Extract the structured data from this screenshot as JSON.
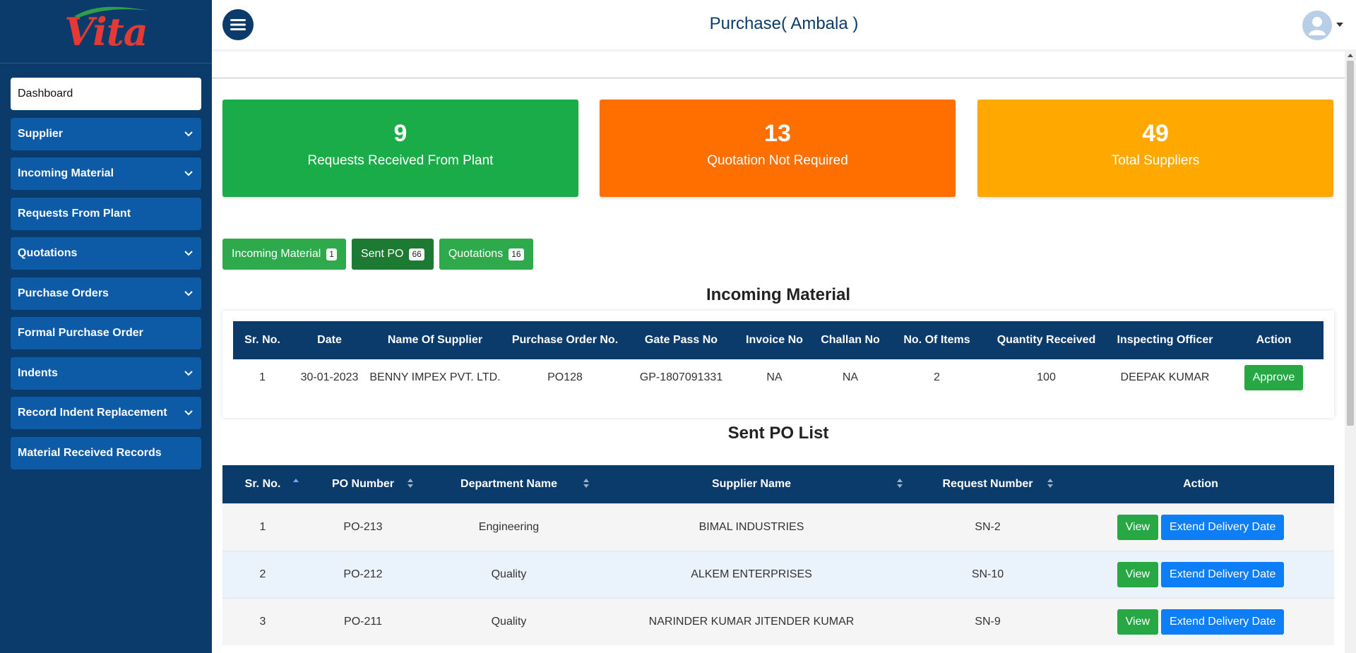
{
  "brand": {
    "logo_text": "Vita"
  },
  "header": {
    "title": "Purchase( Ambala )"
  },
  "sidebar": {
    "items": [
      {
        "label": "Dashboard",
        "has_submenu": false,
        "active": true
      },
      {
        "label": "Supplier",
        "has_submenu": true
      },
      {
        "label": "Incoming Material",
        "has_submenu": true
      },
      {
        "label": "Requests From Plant",
        "has_submenu": false
      },
      {
        "label": "Quotations",
        "has_submenu": true
      },
      {
        "label": "Purchase Orders",
        "has_submenu": true
      },
      {
        "label": "Formal Purchase Order",
        "has_submenu": false
      },
      {
        "label": "Indents",
        "has_submenu": true
      },
      {
        "label": "Record Indent Replacement",
        "has_submenu": true
      },
      {
        "label": "Material Received Records",
        "has_submenu": false
      }
    ]
  },
  "cards": [
    {
      "value": "9",
      "label": "Requests Received From Plant",
      "color": "#1aac48"
    },
    {
      "value": "13",
      "label": "Quotation Not Required",
      "color": "#ff6f00"
    },
    {
      "value": "49",
      "label": "Total Suppliers",
      "color": "#ffa900"
    }
  ],
  "tabs": [
    {
      "label": "Incoming Material",
      "count": "1"
    },
    {
      "label": "Sent PO",
      "count": "66",
      "active": true
    },
    {
      "label": "Quotations",
      "count": "16"
    }
  ],
  "incoming_material": {
    "title": "Incoming Material",
    "columns": [
      "Sr. No.",
      "Date",
      "Name Of Supplier",
      "Purchase Order No.",
      "Gate Pass No",
      "Invoice No",
      "Challan No",
      "No. Of Items",
      "Quantity Received",
      "Inspecting Officer",
      "Action"
    ],
    "rows": [
      {
        "sr": "1",
        "date": "30-01-2023",
        "supplier": "BENNY IMPEX PVT. LTD.",
        "po": "PO128",
        "gate_pass": "GP-1807091331",
        "invoice": "NA",
        "challan": "NA",
        "items": "2",
        "qty": "100",
        "officer": "DEEPAK KUMAR",
        "action": "Approve"
      }
    ]
  },
  "sent_po": {
    "title": "Sent PO List",
    "columns": [
      "Sr. No.",
      "PO Number",
      "Department Name",
      "Supplier Name",
      "Request Number",
      "Action"
    ],
    "view_label": "View",
    "extend_label": "Extend Delivery Date",
    "rows": [
      {
        "sr": "1",
        "po": "PO-213",
        "dept": "Engineering",
        "supplier": "BIMAL INDUSTRIES",
        "request": "SN-2"
      },
      {
        "sr": "2",
        "po": "PO-212",
        "dept": "Quality",
        "supplier": "ALKEM ENTERPRISES",
        "request": "SN-10"
      },
      {
        "sr": "3",
        "po": "PO-211",
        "dept": "Quality",
        "supplier": "NARINDER KUMAR JITENDER KUMAR",
        "request": "SN-9"
      }
    ]
  },
  "colors": {
    "sidebar": "#0b3b6b",
    "menu_item": "#0d5aa7",
    "table_header": "#0b3b6b",
    "view_button": "#28a745",
    "extend_button": "#0d7ef5",
    "tab": "#2ea94b",
    "tab_active": "#1d7a33"
  }
}
